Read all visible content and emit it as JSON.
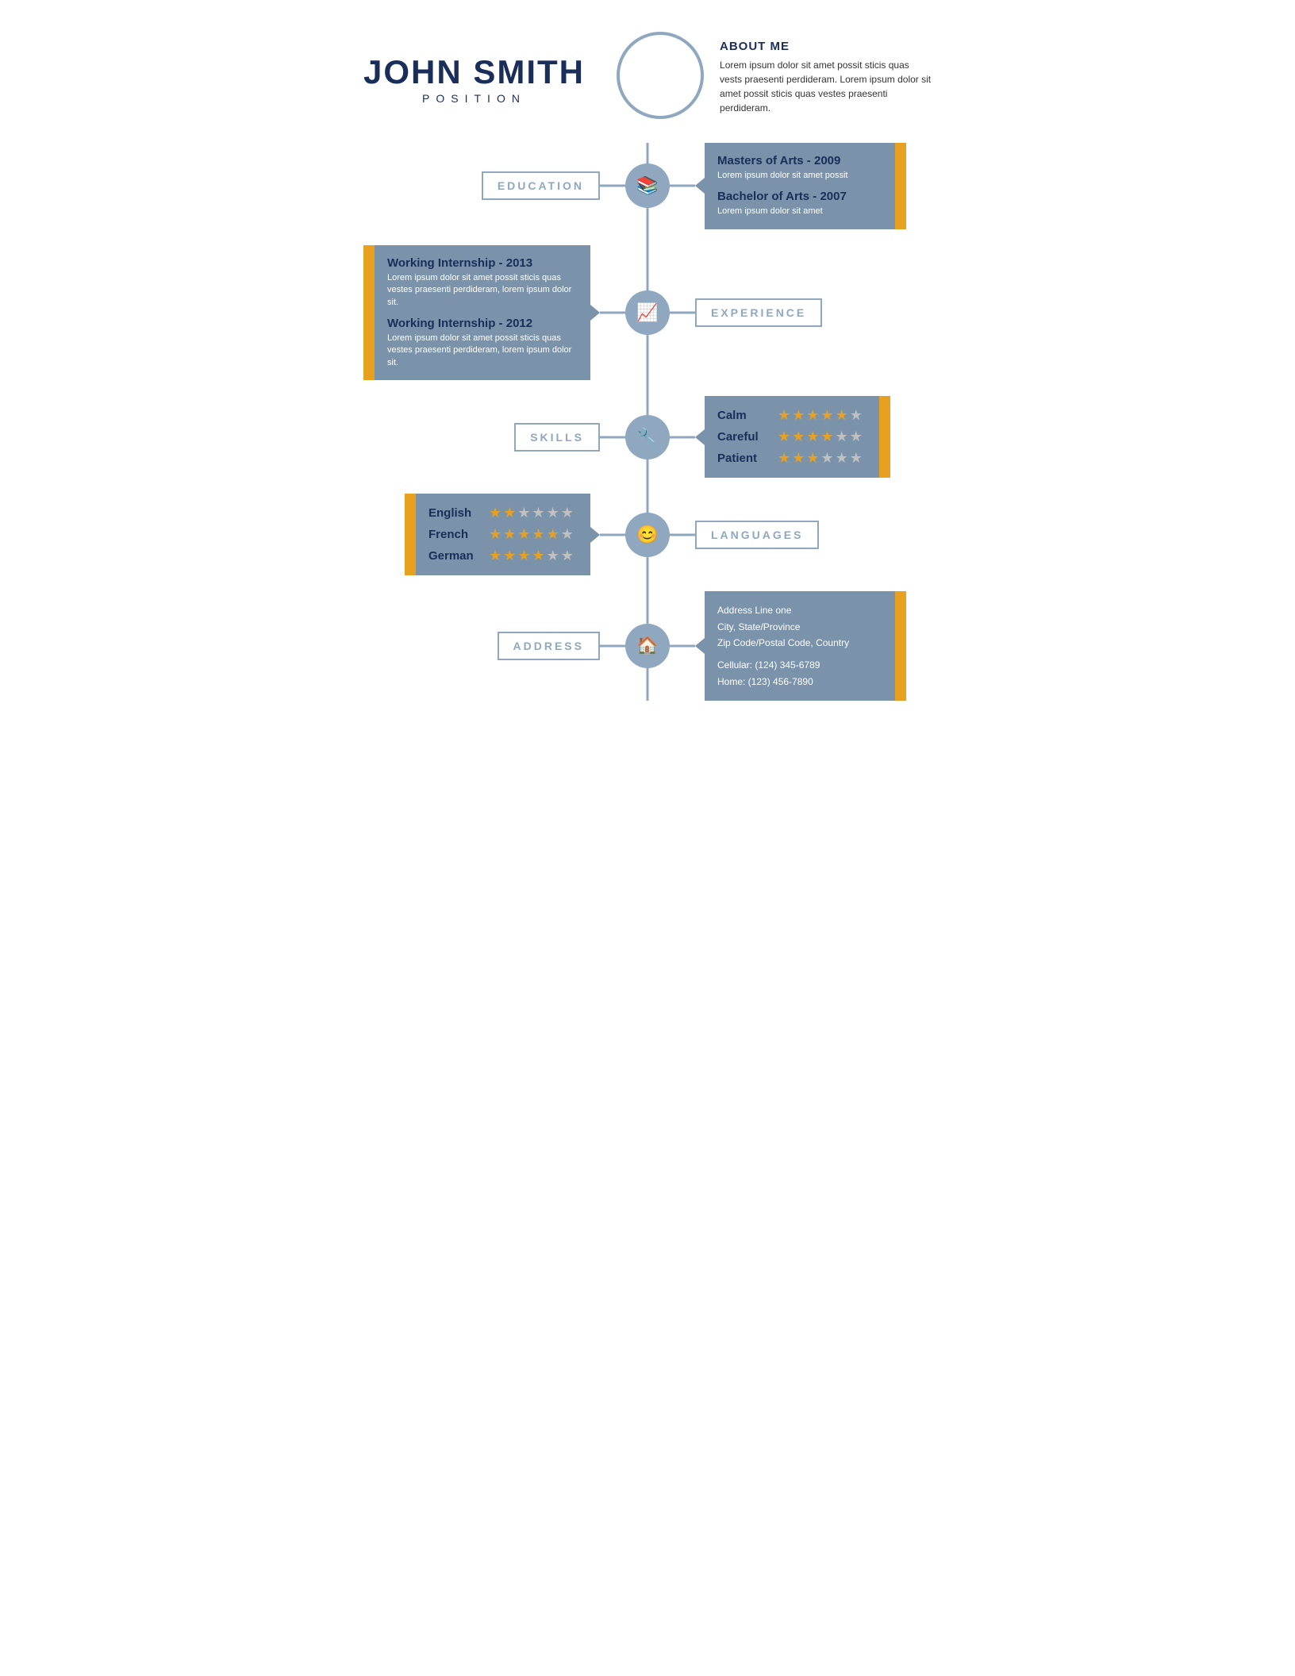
{
  "header": {
    "name": "JOHN SMITH",
    "position": "POSITION",
    "about_title": "ABOUT ME",
    "about_text": "Lorem ipsum dolor sit amet possit sticis quas vests praesenti perdideram. Lorem ipsum dolor sit amet possit sticis quas vestes praesenti perdideram."
  },
  "education": {
    "label": "EDUCATION",
    "entries": [
      {
        "title": "Masters of Arts - 2009",
        "text": "Lorem ipsum dolor sit amet possit"
      },
      {
        "title": "Bachelor of Arts - 2007",
        "text": "Lorem ipsum dolor sit amet"
      }
    ]
  },
  "experience": {
    "label": "EXPERIENCE",
    "entries": [
      {
        "title": "Working Internship - 2013",
        "text": "Lorem ipsum dolor sit amet possit sticis quas vestes praesenti perdideram, lorem ipsum dolor sit."
      },
      {
        "title": "Working Internship - 2012",
        "text": "Lorem ipsum dolor sit amet possit sticis quas vestes praesenti perdideram, lorem ipsum dolor sit."
      }
    ]
  },
  "skills": {
    "label": "SKILLS",
    "entries": [
      {
        "name": "Calm",
        "filled": 5,
        "empty": 1
      },
      {
        "name": "Careful",
        "filled": 4,
        "empty": 2
      },
      {
        "name": "Patient",
        "filled": 3,
        "empty": 3
      }
    ]
  },
  "languages": {
    "label": "LANGUAGES",
    "entries": [
      {
        "name": "English",
        "filled": 2,
        "empty": 4
      },
      {
        "name": "French",
        "filled": 5,
        "empty": 1
      },
      {
        "name": "German",
        "filled": 4,
        "empty": 2
      }
    ]
  },
  "address": {
    "label": "ADDRESS",
    "line1": "Address Line one",
    "line2": "City, State/Province",
    "line3": "Zip Code/Postal Code, Country",
    "cellular": "Cellular: (124) 345-6789",
    "home": "Home: (123) 456-7890"
  },
  "icons": {
    "education": "📚",
    "experience": "📈",
    "skills": "🔧",
    "languages": "😊",
    "address": "🏠"
  }
}
